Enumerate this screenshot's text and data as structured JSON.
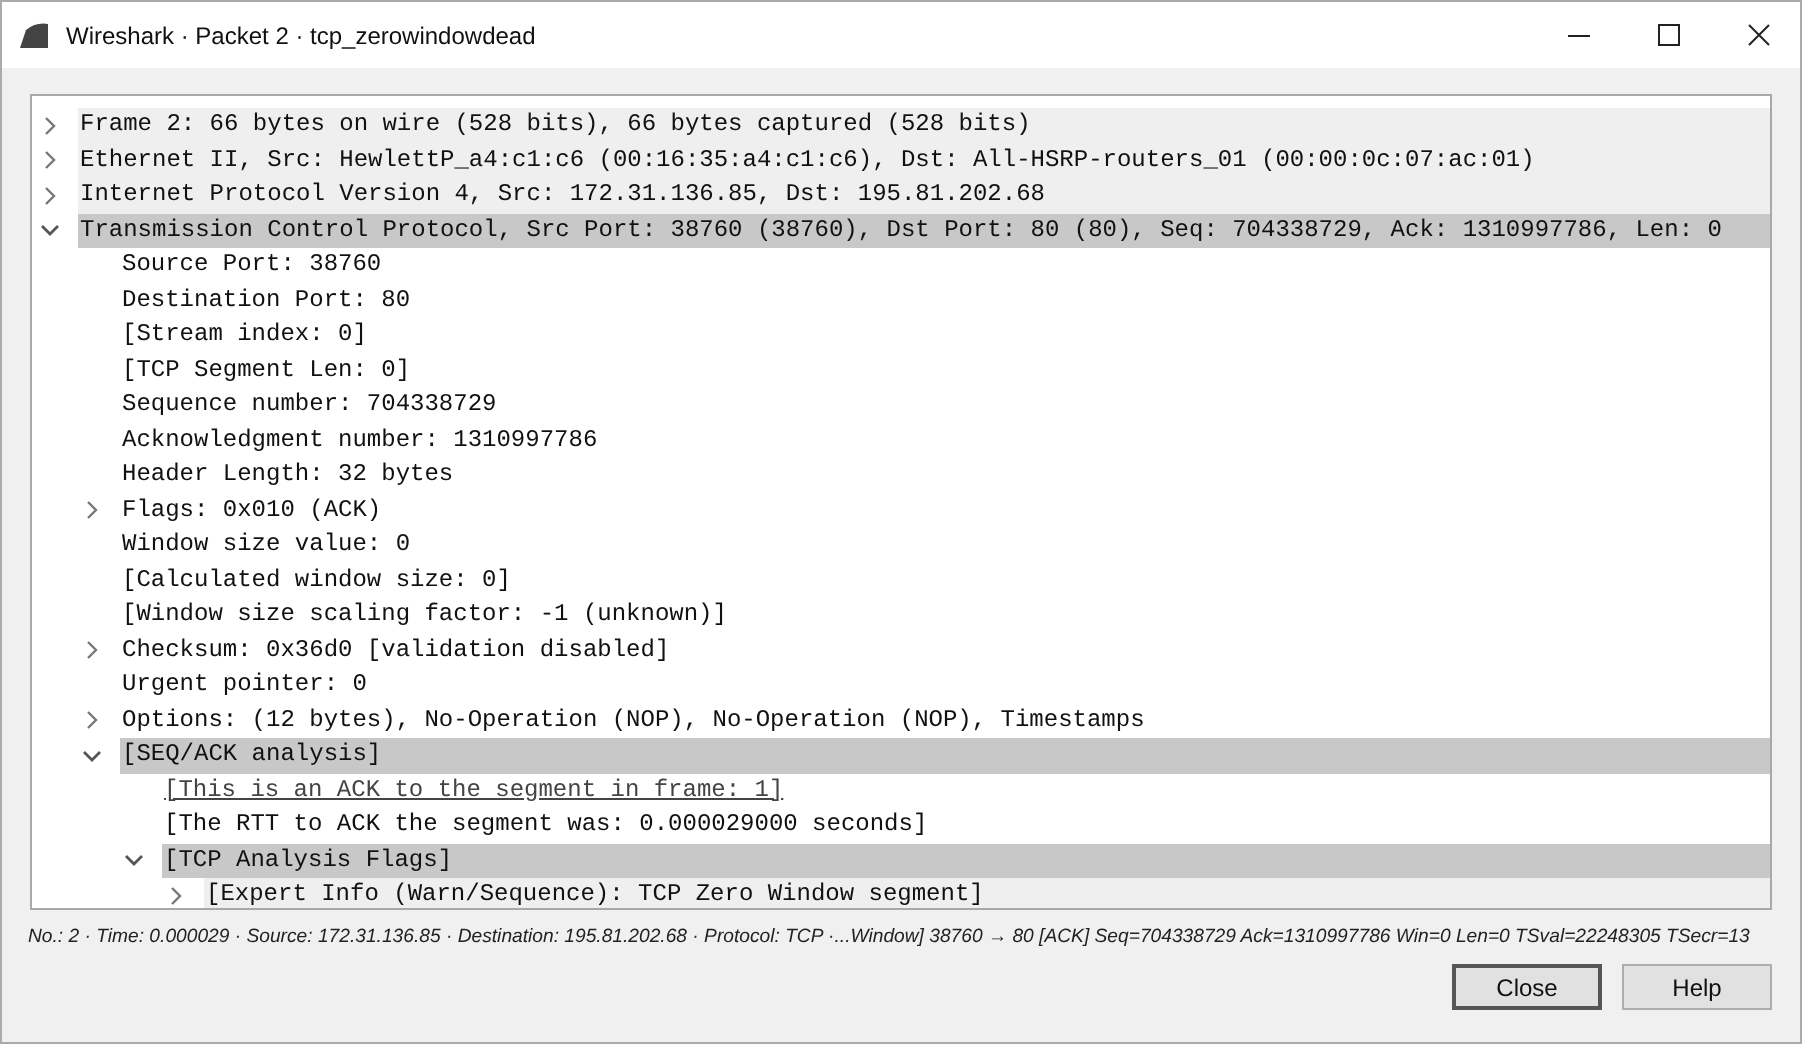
{
  "window": {
    "title": "Wireshark · Packet 2 · tcp_zerowindowdead"
  },
  "tree": [
    {
      "text": "Frame 2: 66 bytes on wire (528 bits), 66 bytes captured (528 bits)",
      "expanded": false,
      "highlighted": false,
      "shaded": true
    },
    {
      "text": "Ethernet II, Src: HewlettP_a4:c1:c6 (00:16:35:a4:c1:c6), Dst: All-HSRP-routers_01 (00:00:0c:07:ac:01)",
      "expanded": false,
      "highlighted": false,
      "shaded": true
    },
    {
      "text": "Internet Protocol Version 4, Src: 172.31.136.85, Dst: 195.81.202.68",
      "expanded": false,
      "highlighted": false,
      "shaded": true
    },
    {
      "text": "Transmission Control Protocol, Src Port: 38760 (38760), Dst Port: 80 (80), Seq: 704338729, Ack: 1310997786, Len: 0",
      "expanded": true,
      "highlighted": true,
      "shaded": false,
      "children": [
        {
          "text": "Source Port: 38760",
          "highlighted": false,
          "shaded": false
        },
        {
          "text": "Destination Port: 80",
          "highlighted": false,
          "shaded": false
        },
        {
          "text": "[Stream index: 0]",
          "highlighted": false,
          "shaded": false
        },
        {
          "text": "[TCP Segment Len: 0]",
          "highlighted": false,
          "shaded": false
        },
        {
          "text": "Sequence number: 704338729",
          "highlighted": false,
          "shaded": false
        },
        {
          "text": "Acknowledgment number: 1310997786",
          "highlighted": false,
          "shaded": false
        },
        {
          "text": "Header Length: 32 bytes",
          "highlighted": false,
          "shaded": false
        },
        {
          "text": "Flags: 0x010 (ACK)",
          "expanded": false,
          "highlighted": false,
          "shaded": false
        },
        {
          "text": "Window size value: 0",
          "highlighted": false,
          "shaded": false
        },
        {
          "text": "[Calculated window size: 0]",
          "highlighted": false,
          "shaded": false
        },
        {
          "text": "[Window size scaling factor: -1 (unknown)]",
          "highlighted": false,
          "shaded": false
        },
        {
          "text": "Checksum: 0x36d0 [validation disabled]",
          "expanded": false,
          "highlighted": false,
          "shaded": false
        },
        {
          "text": "Urgent pointer: 0",
          "highlighted": false,
          "shaded": false
        },
        {
          "text": "Options: (12 bytes), No-Operation (NOP), No-Operation (NOP), Timestamps",
          "expanded": false,
          "highlighted": false,
          "shaded": false
        },
        {
          "text": "[SEQ/ACK analysis]",
          "expanded": true,
          "highlighted": true,
          "shaded": false,
          "children": [
            {
              "text": "[This is an ACK to the segment in frame: 1]",
              "kind": "link",
              "highlighted": false,
              "shaded": false
            },
            {
              "text": "[The RTT to ACK the segment was: 0.000029000 seconds]",
              "kind": "text",
              "highlighted": false,
              "shaded": false
            },
            {
              "text": "[TCP Analysis Flags]",
              "kind": "text",
              "expanded": true,
              "highlighted": true,
              "shaded": false,
              "children": [
                {
                  "text": "[Expert Info (Warn/Sequence): TCP Zero Window segment]",
                  "expanded": false,
                  "highlighted": false,
                  "shaded": true
                }
              ]
            }
          ]
        }
      ]
    }
  ],
  "status_bar": {
    "text": "No.: 2 · Time: 0.000029 · Source: 172.31.136.85 · Destination: 195.81.202.68 · Protocol: TCP ·...Window] 38760 → 80 [ACK] Seq=704338729 Ack=1310997786 Win=0 Len=0 TSval=22248305 TSecr=13"
  },
  "buttons": [
    "Close",
    "Help"
  ]
}
